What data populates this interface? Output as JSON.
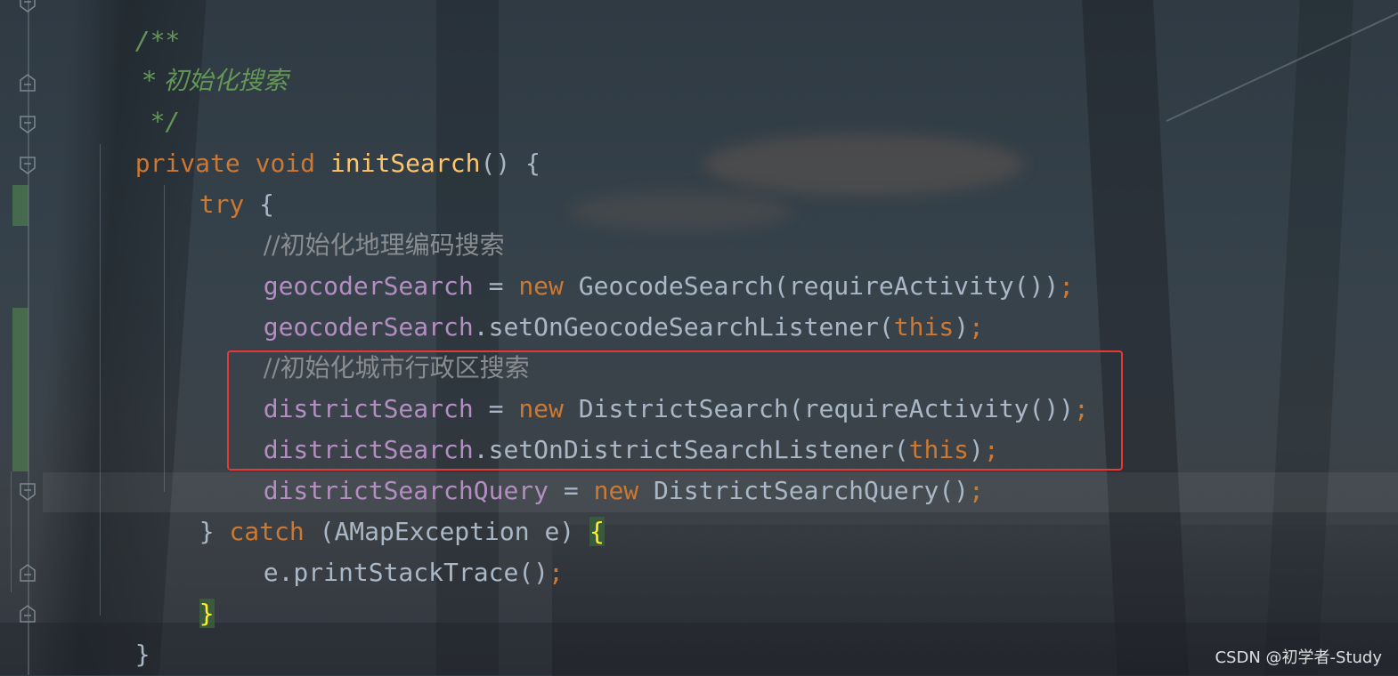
{
  "editor": {
    "lines": {
      "doc_open": "/**",
      "doc_text": " * 初始化搜索",
      "doc_close": " */",
      "method_private": "private",
      "method_void": "void",
      "method_name": "initSearch",
      "method_sig_rest": "() {",
      "try_kw": "try",
      "try_brace": " {",
      "comment_geo": "//初始化地理编码搜索",
      "geo1_field": "geocoderSearch",
      "geo1_eq": " = ",
      "geo1_new": "new",
      "geo1_rest": " GeocodeSearch(requireActivity())",
      "geo1_semi": ";",
      "geo2_field": "geocoderSearch",
      "geo2_call": ".setOnGeocodeSearchListener(",
      "geo2_this": "this",
      "geo2_close": ")",
      "geo2_semi": ";",
      "comment_district": "//初始化城市行政区搜索",
      "d1_field": "districtSearch",
      "d1_eq": " = ",
      "d1_new": "new",
      "d1_rest": " DistrictSearch(requireActivity())",
      "d1_semi": ";",
      "d2_field": "districtSearch",
      "d2_call": ".setOnDistrictSearchListener(",
      "d2_this": "this",
      "d2_close": ")",
      "d2_semi": ";",
      "d3_field": "districtSearchQuery",
      "d3_eq": " = ",
      "d3_new": "new",
      "d3_rest": " DistrictSearchQuery()",
      "d3_semi": ";",
      "catch_close": "} ",
      "catch_kw": "catch",
      "catch_args": " (AMapException e) ",
      "catch_brace": "{",
      "print_call": "e.printStackTrace()",
      "print_semi": ";",
      "close_catch": "}",
      "close_method": "}"
    }
  },
  "watermark": "CSDN @初学者-Study",
  "colors": {
    "keyword": "#cc7832",
    "method": "#ffc66d",
    "field": "#b48ec2",
    "comment": "#8a8d90",
    "doc_comment": "#629755",
    "text": "#a9b7c6",
    "highlight_box": "#e53935",
    "matched_brace": "#ffef28"
  },
  "icons": [
    "fold-marker-icon"
  ]
}
